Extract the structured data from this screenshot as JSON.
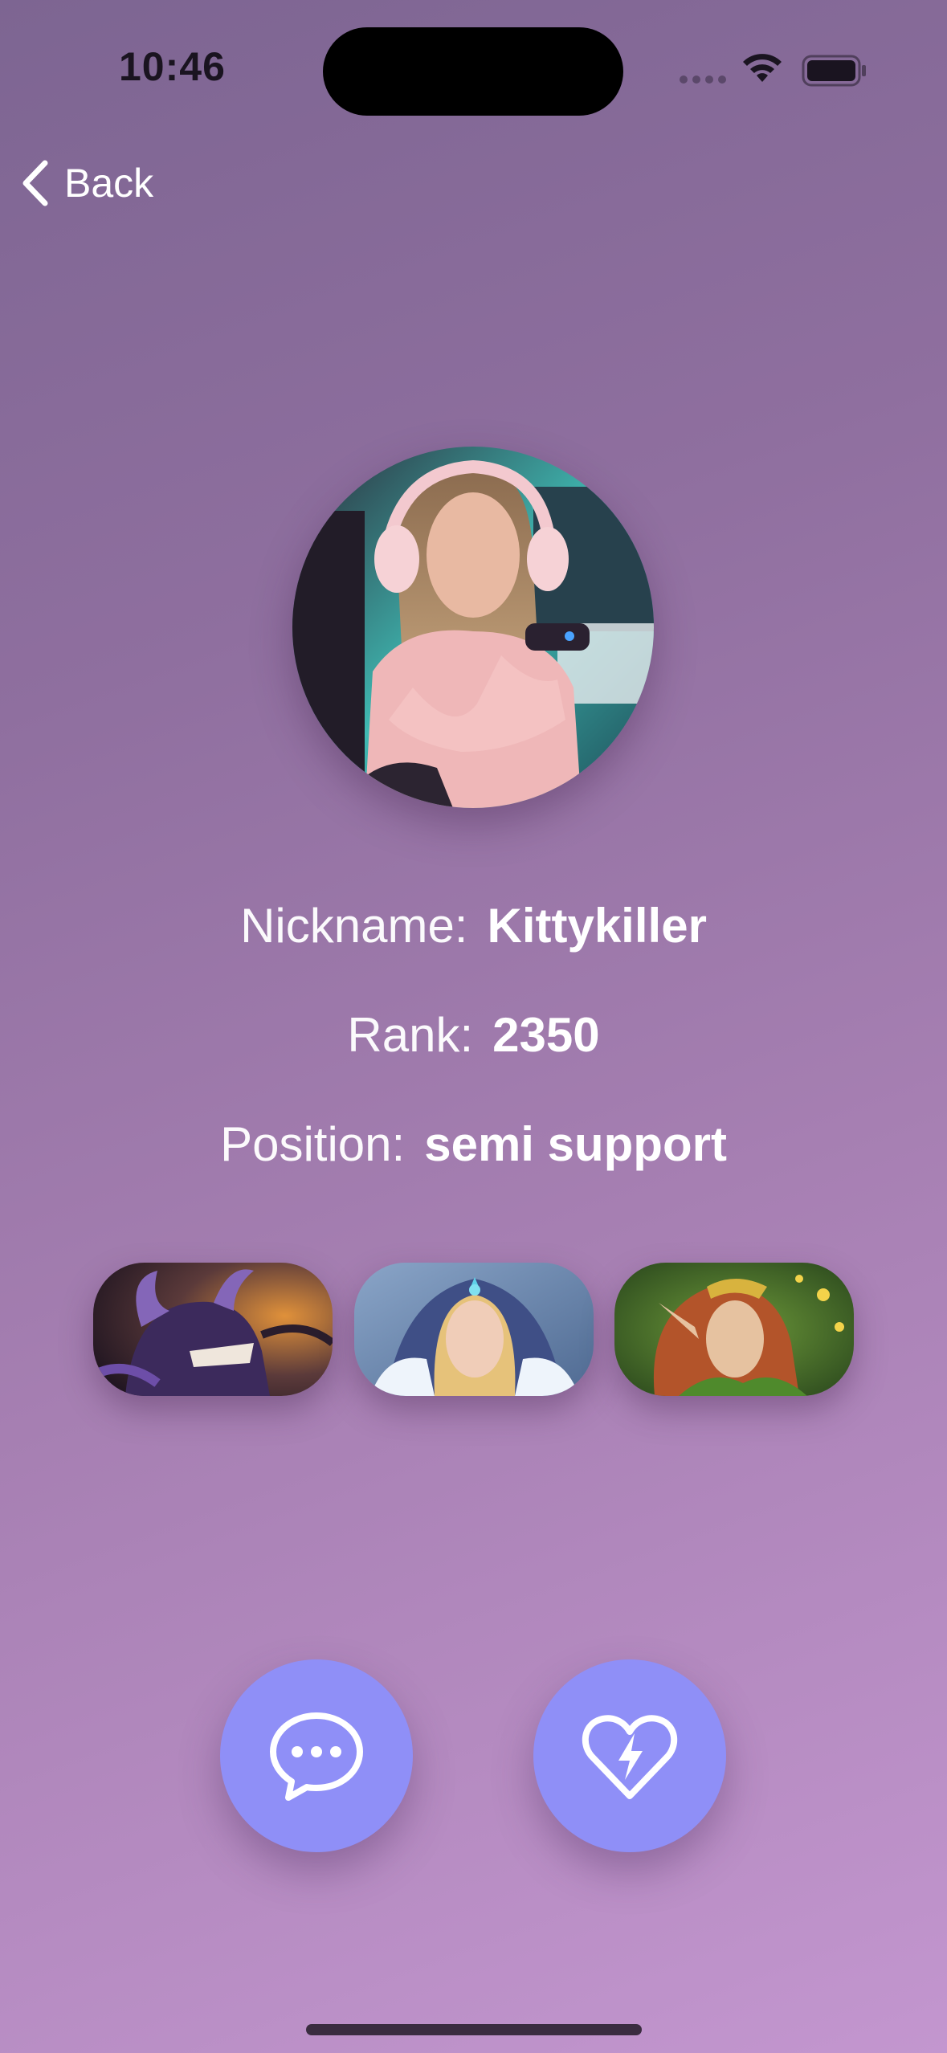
{
  "status_bar": {
    "time": "10:46",
    "icons": [
      "signal-icon",
      "wifi-icon",
      "battery-icon"
    ]
  },
  "nav": {
    "back_label": "Back",
    "back_icon": "chevron-left-icon"
  },
  "profile": {
    "avatar_alt": "profile-photo",
    "nickname_label": "Nickname:",
    "nickname": "Kittykiller",
    "rank_label": "Rank:",
    "rank": "2350",
    "position_label": "Position:",
    "position": "semi support"
  },
  "heroes": [
    {
      "image": "hero-portrait-1"
    },
    {
      "image": "hero-portrait-2"
    },
    {
      "image": "hero-portrait-3"
    }
  ],
  "actions": [
    {
      "icon": "chat-bubble-icon"
    },
    {
      "icon": "heart-bolt-icon"
    }
  ],
  "colors": {
    "background_start": "#7d6592",
    "background_end": "#c396cf",
    "action_button": "#8f8ff7",
    "text": "#ffffff"
  }
}
